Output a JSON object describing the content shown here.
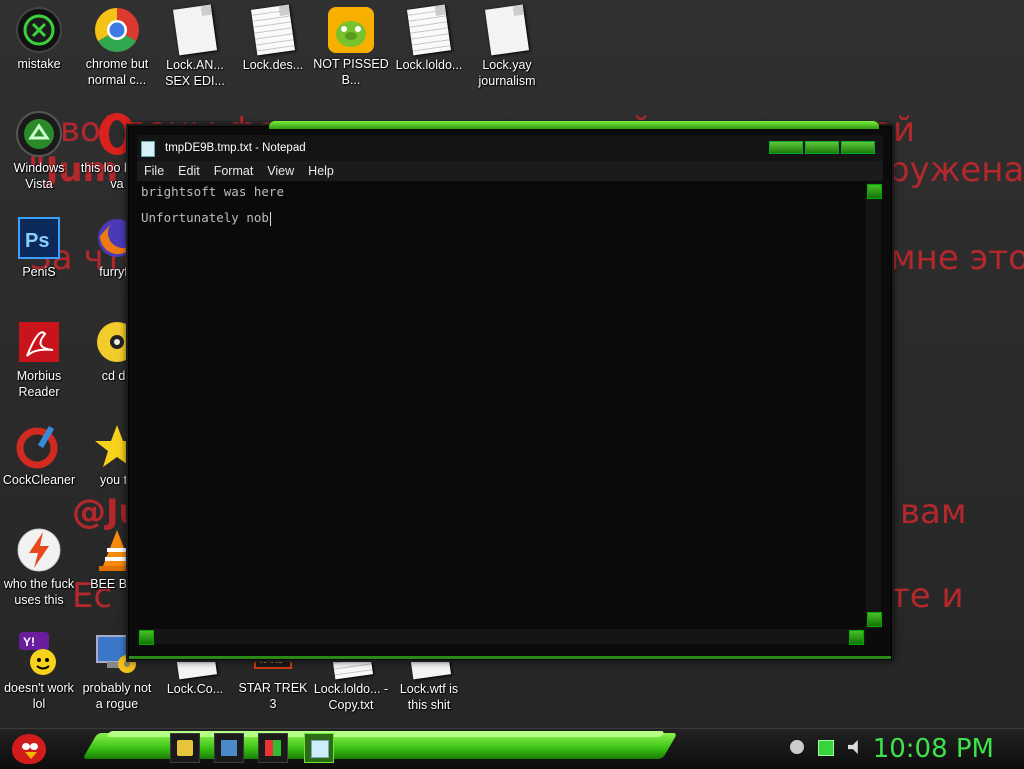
{
  "wallpaper": {
    "lines": [
      "войдены флинованны хакерской группировкой",
      "\"Jum",
      "ружена",
      "За что",
      "мне это",
      "@Ju",
      "вам",
      "Ес",
      "те и"
    ]
  },
  "desktop_icons": [
    {
      "label": "mistake",
      "icon": "razer-icon"
    },
    {
      "label": "chrome but normal c...",
      "icon": "chrome-icon"
    },
    {
      "label": "Lock.AN... SEX EDI...",
      "icon": "document-icon"
    },
    {
      "label": "Lock.des...",
      "icon": "document-icon"
    },
    {
      "label": "NOT PISSED B...",
      "icon": "bad-piggies-icon"
    },
    {
      "label": "Lock.loldo...",
      "icon": "text-document-icon"
    },
    {
      "label": "Lock.yay journalism",
      "icon": "document-icon"
    },
    {
      "label": "Windows Vista",
      "icon": "recycle-bin-icon"
    },
    {
      "label": "this loo like a va",
      "icon": "opera-icon"
    },
    {
      "label": "PeniS",
      "icon": "photoshop-icon"
    },
    {
      "label": "furryfo",
      "icon": "firefox-icon"
    },
    {
      "label": "Morbius Reader",
      "icon": "adobe-reader-icon"
    },
    {
      "label": "cd dri",
      "icon": "cd-drive-icon"
    },
    {
      "label": "CockCleaner",
      "icon": "ccleaner-icon"
    },
    {
      "label": "you tri",
      "icon": "star-icon"
    },
    {
      "label": "who the fuck uses this",
      "icon": "bolt-icon"
    },
    {
      "label": "BEE BEE",
      "icon": "vlc-icon"
    },
    {
      "label": "doesn't work lol",
      "icon": "yahoo-messenger-icon"
    },
    {
      "label": "probably not a rogue",
      "icon": "computer-settings-icon"
    },
    {
      "label": "Lock.Co...",
      "icon": "document-icon"
    },
    {
      "label": "STAR TREK 3",
      "icon": "star-wars-icon"
    },
    {
      "label": "Lock.loldo... - Copy.txt",
      "icon": "text-document-icon"
    },
    {
      "label": "Lock.wtf is this shit",
      "icon": "document-icon"
    }
  ],
  "notepad": {
    "title": "tmpDE9B.tmp.txt - Notepad",
    "menu": [
      "File",
      "Edit",
      "Format",
      "View",
      "Help"
    ],
    "content_lines": [
      "brightsoft was here",
      "Unfortunately nob"
    ]
  },
  "taskbar": {
    "clock": "10:08 PM",
    "pinned": [
      "explorer-icon",
      "media-player-icon",
      "windows-flag-icon",
      "notepad-icon"
    ],
    "tray": [
      "network-icon",
      "battery-icon",
      "volume-icon"
    ]
  },
  "colors": {
    "accent_green": "#3ee24a",
    "wallpaper_text": "#c0282d",
    "window_bg": "#0a0a0a"
  }
}
